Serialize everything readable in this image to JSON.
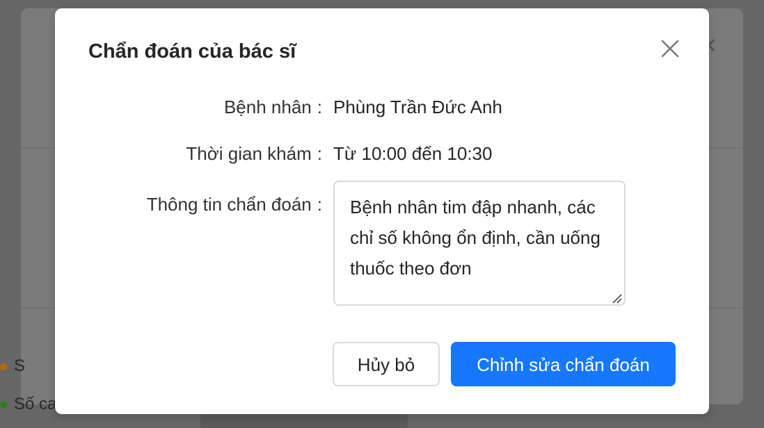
{
  "background": {
    "items": [
      {
        "label": "S",
        "dot_color": "#b36b00"
      },
      {
        "label": "Số ca",
        "dot_color": "#2e7d1a"
      }
    ]
  },
  "modal": {
    "title": "Chẩn đoán của bác sĩ",
    "close_icon": "close-icon",
    "fields": {
      "patient": {
        "label": "Bệnh nhân",
        "colon": ":",
        "value": "Phùng Trần Đức Anh"
      },
      "time": {
        "label": "Thời gian khám",
        "colon": ":",
        "value": "Từ 10:00 đến 10:30"
      },
      "diagnosis": {
        "label": "Thông tin chẩn đoán",
        "colon": ":",
        "value": "Bệnh nhân tim đập nhanh, các chỉ số không ổn định, cần uống thuốc theo đơn"
      }
    },
    "buttons": {
      "cancel_label": "Hủy bỏ",
      "primary_label": "Chỉnh sửa chẩn đoán"
    },
    "colors": {
      "primary": "#1677ff",
      "border": "#d9d9d9",
      "overlay": "#666666"
    }
  }
}
